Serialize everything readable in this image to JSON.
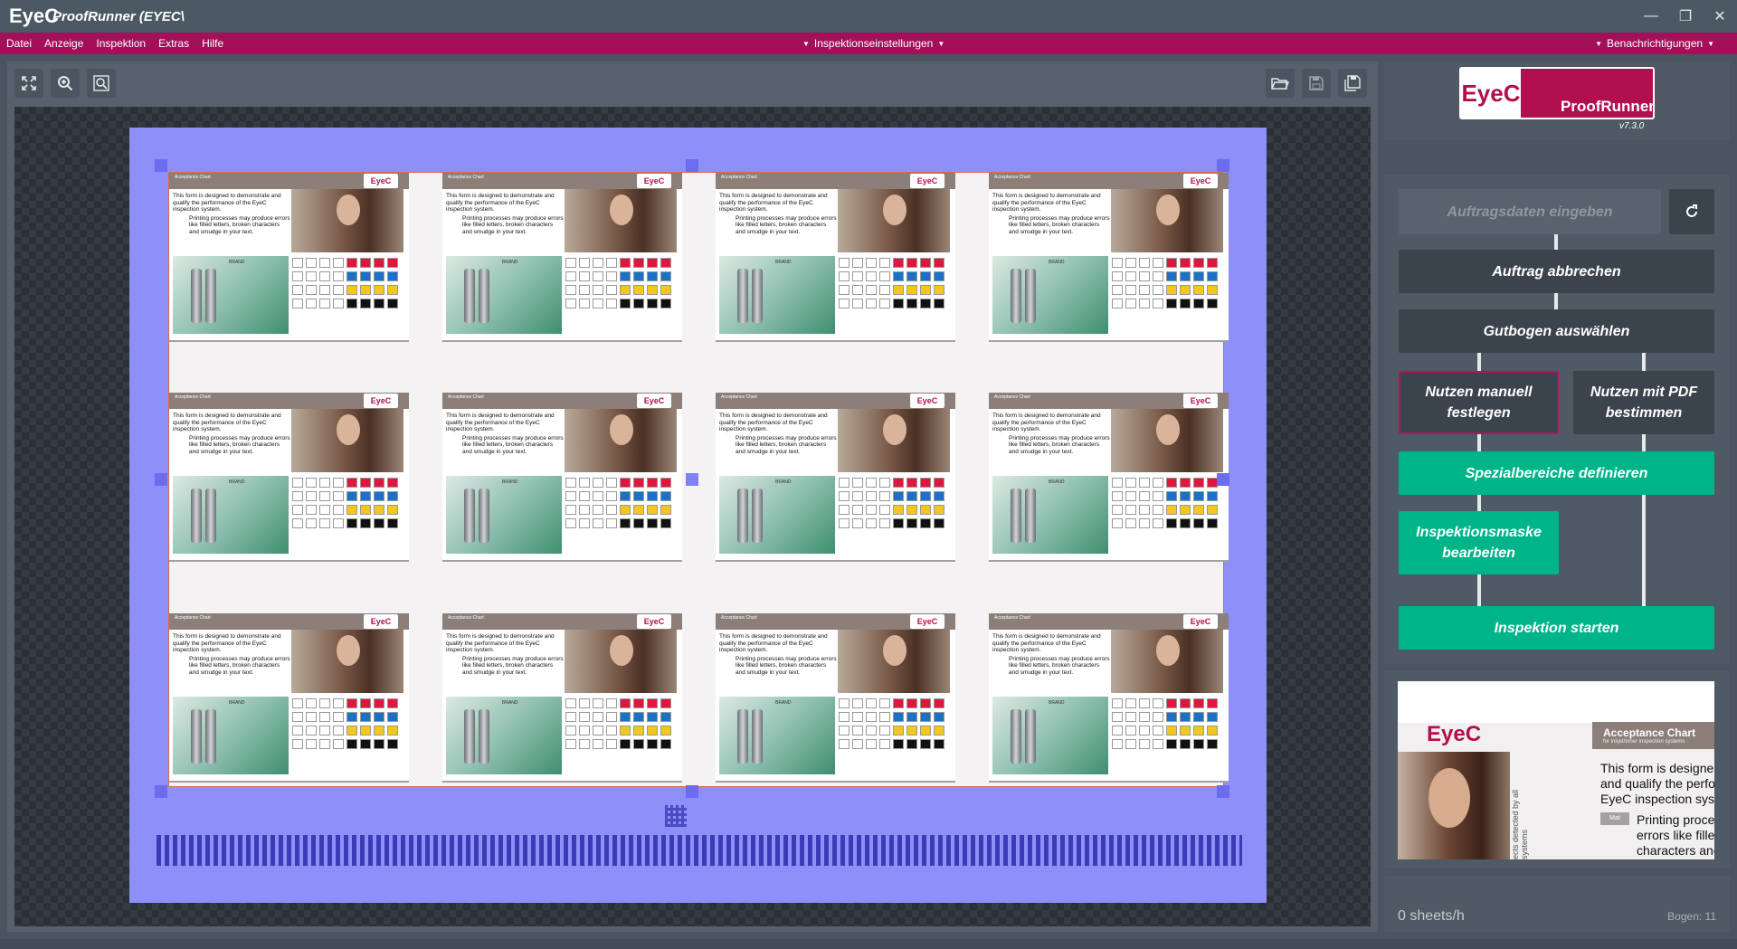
{
  "window": {
    "logo": "EyeC",
    "title": "ProofRunner  (EYEC\\",
    "controls": [
      "minimize",
      "restore",
      "close"
    ]
  },
  "menubar": {
    "items": [
      "Datei",
      "Anzeige",
      "Inspektion",
      "Extras",
      "Hilfe"
    ],
    "center": "Inspektionseinstellungen",
    "right": "Benachrichtigungen"
  },
  "toolbar": {
    "left_icons": [
      "fit-to-screen-icon",
      "zoom-in-icon",
      "zoom-region-icon"
    ],
    "right_icons": [
      "open-folder-icon",
      "save-icon",
      "save-as-icon"
    ]
  },
  "chart_cell": {
    "header_title": "Acceptance Chart",
    "logo": "EyeC",
    "text": "This form is designed to demonstrate and qualify the performance of the EyeC inspection system.",
    "text2": "Printing processes may produce errors like filled letters, broken characters and smudge in your text.",
    "brand": "BRAND"
  },
  "swatch_colors": [
    "#ffffff",
    "#ffffff",
    "#ffffff",
    "#ffffff",
    "#e0163e",
    "#e0163e",
    "#e0163e",
    "#e0163e",
    "#ffffff",
    "#ffffff",
    "#ffffff",
    "#ffffff",
    "#1a72c6",
    "#1a72c6",
    "#1a72c6",
    "#1a72c6",
    "#ffffff",
    "#ffffff",
    "#ffffff",
    "#ffffff",
    "#f2c81a",
    "#f2c81a",
    "#f2c81a",
    "#f2c81a",
    "#ffffff",
    "#ffffff",
    "#ffffff",
    "#ffffff",
    "#111111",
    "#111111",
    "#111111",
    "#111111"
  ],
  "brand_panel": {
    "logo": "EyeC",
    "product": "ProofRunner",
    "version": "v7.3.0"
  },
  "workflow": {
    "order_entry": "Auftragsdaten eingeben",
    "cancel_order": "Auftrag abbrechen",
    "select_proof": "Gutbogen auswählen",
    "manual_layout_line1": "Nutzen manuell",
    "manual_layout_line2": "festlegen",
    "pdf_layout_line1": "Nutzen mit PDF",
    "pdf_layout_line2": "bestimmen",
    "special_areas": "Spezialbereiche definieren",
    "mask_line1": "Inspektionsmaske",
    "mask_line2": "bearbeiten",
    "start": "Inspektion starten"
  },
  "preview": {
    "logo": "EyeC",
    "title": "Acceptance Chart",
    "subtitle": "for inkjet/toner inspection systems",
    "line1": "This form is designe",
    "line2": "and qualify the perfo",
    "line3": "EyeC inspection sys",
    "line4": "Printing proces",
    "line5": "errors like fille",
    "line6": "characters and",
    "side_text": "ects detected by all systems",
    "tag": "Mat"
  },
  "status": {
    "speed": "0 sheets/h",
    "bogen": "Bogen:  11"
  }
}
